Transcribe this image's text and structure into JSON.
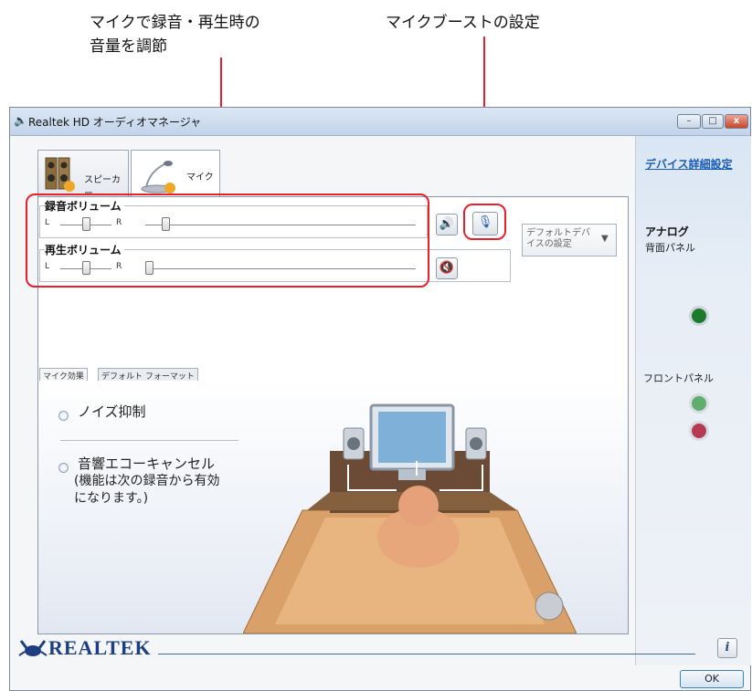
{
  "callouts": {
    "left": "マイクで録音・再生時の\n音量を調節",
    "right": "マイクブーストの設定"
  },
  "window": {
    "title": "Realtek HD オーディオマネージャ",
    "buttons": {
      "minimize": "–",
      "maximize": "□",
      "close": "x"
    }
  },
  "device_tabs": [
    {
      "label": "スピーカー",
      "active": false
    },
    {
      "label": "マイク",
      "active": true
    }
  ],
  "recording_volume": {
    "title": "録音ボリューム",
    "left": "L",
    "right": "R",
    "balance": 0.5,
    "volume": 0.05
  },
  "playback_volume": {
    "title": "再生ボリューム",
    "left": "L",
    "right": "R",
    "balance": 0.5,
    "volume": 0.0,
    "muted": true
  },
  "default_device": {
    "label": "デフォルトデバイスの設定"
  },
  "sub_tabs": [
    {
      "label": "マイク効果",
      "active": true
    },
    {
      "label": "デフォルト フォーマット",
      "active": false
    }
  ],
  "effects": {
    "noise": "ノイズ抑制",
    "echo": "音響エコーキャンセル",
    "echo_note": "(機能は次の録音から有効\nになります。)"
  },
  "right_panel": {
    "device_link": "デバイス詳細設定",
    "analog": "アナログ",
    "back_panel": "背面パネル",
    "front_panel": "フロントパネル"
  },
  "footer": {
    "brand": "REALTEK",
    "ok": "OK",
    "info": "i"
  },
  "colors": {
    "callout": "#e8202e",
    "link": "#1a5bb8",
    "brand": "#1d3f82"
  }
}
